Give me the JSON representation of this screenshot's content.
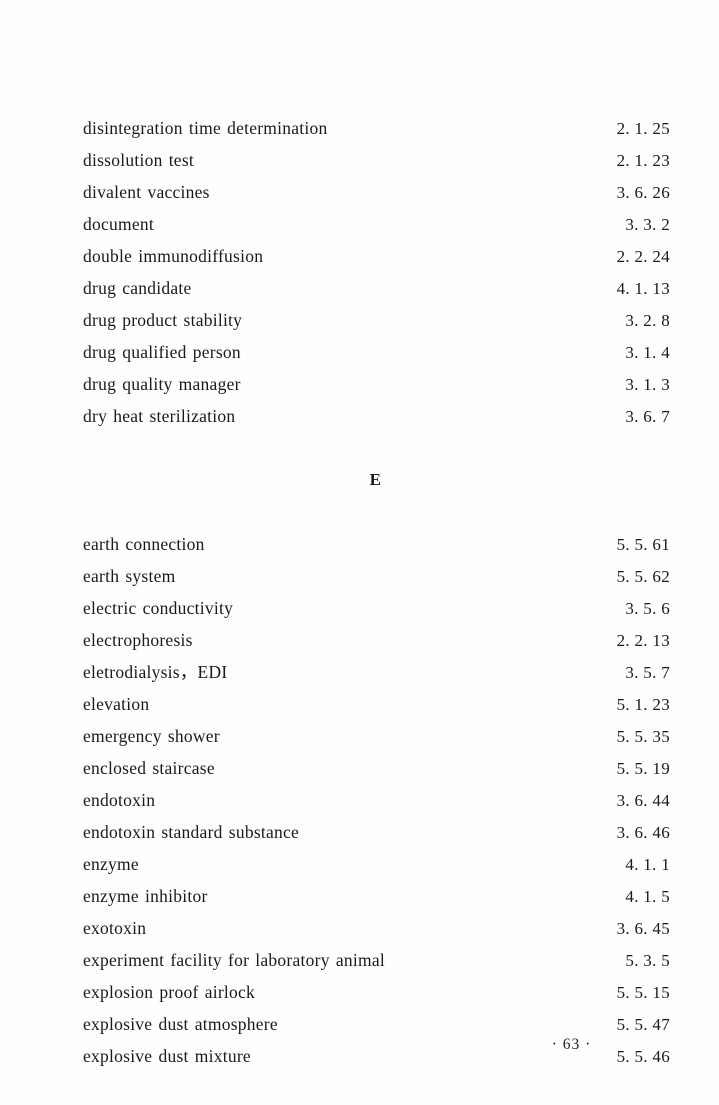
{
  "page": {
    "folio": "· 63 ·",
    "kind": "book-index-page"
  },
  "index": {
    "blocks": [
      {
        "letter": null,
        "entries": [
          {
            "term": "disintegration time determination",
            "ref": "2. 1. 25"
          },
          {
            "term": "dissolution test",
            "ref": "2. 1. 23"
          },
          {
            "term": "divalent vaccines",
            "ref": "3. 6. 26"
          },
          {
            "term": "document",
            "ref": "3. 3. 2"
          },
          {
            "term": "double immunodiffusion",
            "ref": "2. 2. 24"
          },
          {
            "term": "drug candidate",
            "ref": "4. 1. 13"
          },
          {
            "term": "drug product stability",
            "ref": "3. 2. 8"
          },
          {
            "term": "drug qualified person",
            "ref": "3. 1. 4"
          },
          {
            "term": "drug quality manager",
            "ref": "3. 1. 3"
          },
          {
            "term": "dry heat sterilization",
            "ref": "3. 6. 7"
          }
        ]
      },
      {
        "letter": "E",
        "entries": [
          {
            "term": "earth connection",
            "ref": "5. 5. 61"
          },
          {
            "term": "earth system",
            "ref": "5. 5. 62"
          },
          {
            "term": "electric conductivity",
            "ref": "3. 5. 6"
          },
          {
            "term": "electrophoresis",
            "ref": "2. 2. 13"
          },
          {
            "term": "eletrodialysis，EDI",
            "ref": "3. 5. 7"
          },
          {
            "term": "elevation",
            "ref": "5. 1. 23"
          },
          {
            "term": "emergency shower",
            "ref": "5. 5. 35"
          },
          {
            "term": "enclosed staircase",
            "ref": "5. 5. 19"
          },
          {
            "term": "endotoxin",
            "ref": "3. 6. 44"
          },
          {
            "term": "endotoxin standard substance",
            "ref": "3. 6. 46"
          },
          {
            "term": "enzyme",
            "ref": "4. 1. 1"
          },
          {
            "term": "enzyme inhibitor",
            "ref": "4. 1. 5"
          },
          {
            "term": "exotoxin",
            "ref": "3. 6. 45"
          },
          {
            "term": "experiment facility for laboratory animal",
            "ref": "5. 3. 5"
          },
          {
            "term": "explosion proof airlock",
            "ref": "5. 5. 15"
          },
          {
            "term": "explosive dust atmosphere",
            "ref": "5. 5. 47"
          },
          {
            "term": "explosive dust mixture",
            "ref": "5. 5. 46"
          }
        ]
      }
    ]
  }
}
